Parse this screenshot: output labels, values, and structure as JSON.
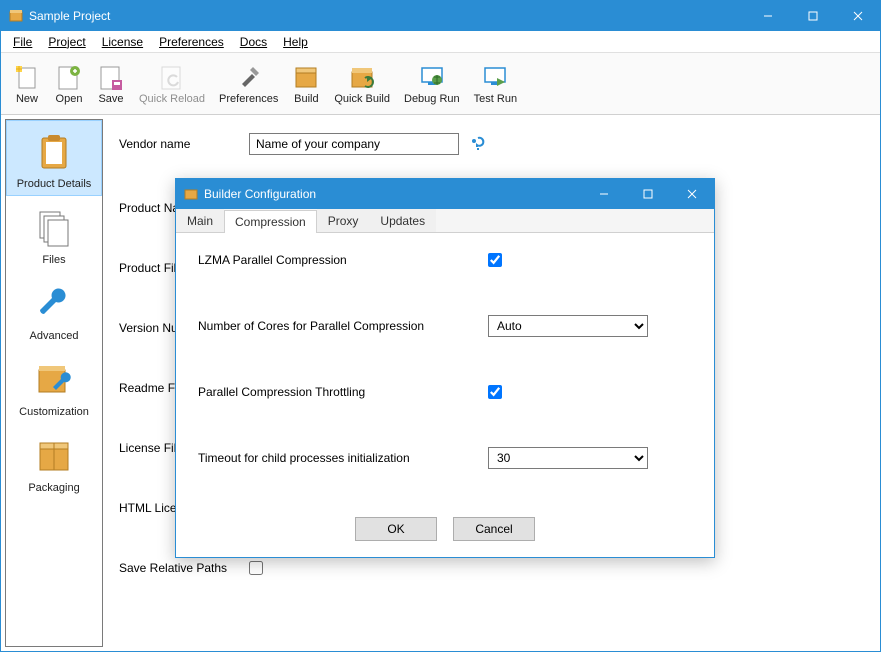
{
  "colors": {
    "accent": "#2a8dd4",
    "iconGold": "#e6a845",
    "iconDark": "#555"
  },
  "window": {
    "title": "Sample Project"
  },
  "menu": {
    "file": "File",
    "project": "Project",
    "license": "License",
    "preferences": "Preferences",
    "docs": "Docs",
    "help": "Help"
  },
  "toolbar": {
    "new": "New",
    "open": "Open",
    "save": "Save",
    "quick_reload": "Quick Reload",
    "preferences": "Preferences",
    "build": "Build",
    "quick_build": "Quick Build",
    "debug_run": "Debug Run",
    "test_run": "Test Run"
  },
  "sidebar": {
    "items": [
      {
        "label": "Product Details"
      },
      {
        "label": "Files"
      },
      {
        "label": "Advanced"
      },
      {
        "label": "Customization"
      },
      {
        "label": "Packaging"
      }
    ]
  },
  "form": {
    "vendor_name_label": "Vendor name",
    "vendor_name_placeholder": "Name of your company",
    "vendor_name_value": "Name of your company",
    "product_name_label": "Product Na",
    "product_files_label": "Product Fil",
    "version_label": "Version Nu",
    "readme_label": "Readme Fi",
    "license_file_label": "License File",
    "html_lic_label": "HTML Lice",
    "save_relative_label": "Save Relative Paths",
    "save_relative_checked": false
  },
  "dialog": {
    "title": "Builder Configuration",
    "tabs": [
      {
        "label": "Main"
      },
      {
        "label": "Compression"
      },
      {
        "label": "Proxy"
      },
      {
        "label": "Updates"
      }
    ],
    "active_tab": 1,
    "fields": {
      "lzma_label": "LZMA Parallel Compression",
      "lzma_checked": true,
      "cores_label": "Number of Cores for Parallel Compression",
      "cores_value": "Auto",
      "throttle_label": "Parallel Compression Throttling",
      "throttle_checked": true,
      "timeout_label": "Timeout for child processes initialization",
      "timeout_value": "30"
    },
    "buttons": {
      "ok": "OK",
      "cancel": "Cancel"
    }
  }
}
